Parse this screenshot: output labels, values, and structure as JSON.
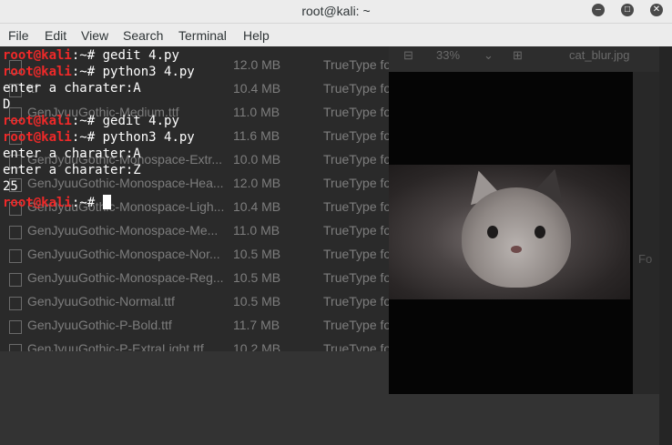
{
  "window": {
    "title": "root@kali: ~",
    "controls": {
      "minimize": "minimize-icon",
      "maximize": "maximize-icon",
      "close": "close-icon"
    }
  },
  "menu": [
    "File",
    "Edit",
    "View",
    "Search",
    "Terminal",
    "Help"
  ],
  "terminal": {
    "prompt_user": "root@kali",
    "prompt_path": ":~#",
    "lines": [
      {
        "type": "prompt",
        "cmd": "gedit 4.py"
      },
      {
        "type": "prompt",
        "cmd": "python3 4.py"
      },
      {
        "type": "output",
        "text": "enter a charater:A"
      },
      {
        "type": "output",
        "text": "D"
      },
      {
        "type": "prompt",
        "cmd": "gedit 4.py"
      },
      {
        "type": "prompt",
        "cmd": "python3 4.py"
      },
      {
        "type": "output",
        "text": "enter a charater:A"
      },
      {
        "type": "output",
        "text": "enter a charater:Z"
      },
      {
        "type": "output",
        "text": "25"
      },
      {
        "type": "prompt",
        "cmd": "",
        "cursor": true
      }
    ]
  },
  "background": {
    "files": [
      {
        "name": "",
        "size": "12.0 MB",
        "type": "TrueType fo"
      },
      {
        "name": "ttf",
        "size": "10.4 MB",
        "type": "TrueType fo"
      },
      {
        "name": "GenJyuuGothic-Medium.ttf",
        "size": "11.0 MB",
        "type": "TrueType fo"
      },
      {
        "name": "",
        "size": "11.6 MB",
        "type": "TrueType fo"
      },
      {
        "name": "GenJyuuGothic-Monospace-Extr...",
        "size": "10.0 MB",
        "type": "TrueType fo"
      },
      {
        "name": "GenJyuuGothic-Monospace-Hea...",
        "size": "12.0 MB",
        "type": "TrueType fo"
      },
      {
        "name": "GenJyuuGothic-Monospace-Ligh...",
        "size": "10.4 MB",
        "type": "TrueType fo"
      },
      {
        "name": "GenJyuuGothic-Monospace-Me...",
        "size": "11.0 MB",
        "type": "TrueType fo"
      },
      {
        "name": "GenJyuuGothic-Monospace-Nor...",
        "size": "10.5 MB",
        "type": "TrueType fo"
      },
      {
        "name": "GenJyuuGothic-Monospace-Reg...",
        "size": "10.5 MB",
        "type": "TrueType fo"
      },
      {
        "name": "GenJyuuGothic-Normal.ttf",
        "size": "10.5 MB",
        "type": "TrueType fo"
      },
      {
        "name": "GenJyuuGothic-P-Bold.ttf",
        "size": "11.7 MB",
        "type": "TrueType fo"
      },
      {
        "name": "GenJyuuGothic-P-ExtraLight.ttf",
        "size": "10.2 MB",
        "type": "TrueType fo"
      }
    ],
    "viewer": {
      "zoom": "33%",
      "filename": "cat_blur.jpg",
      "side_label": "Fo"
    }
  },
  "colors": {
    "prompt_user": "#ef2929",
    "terminal_bg": "#1e1e1e",
    "text": "#ffffff"
  }
}
